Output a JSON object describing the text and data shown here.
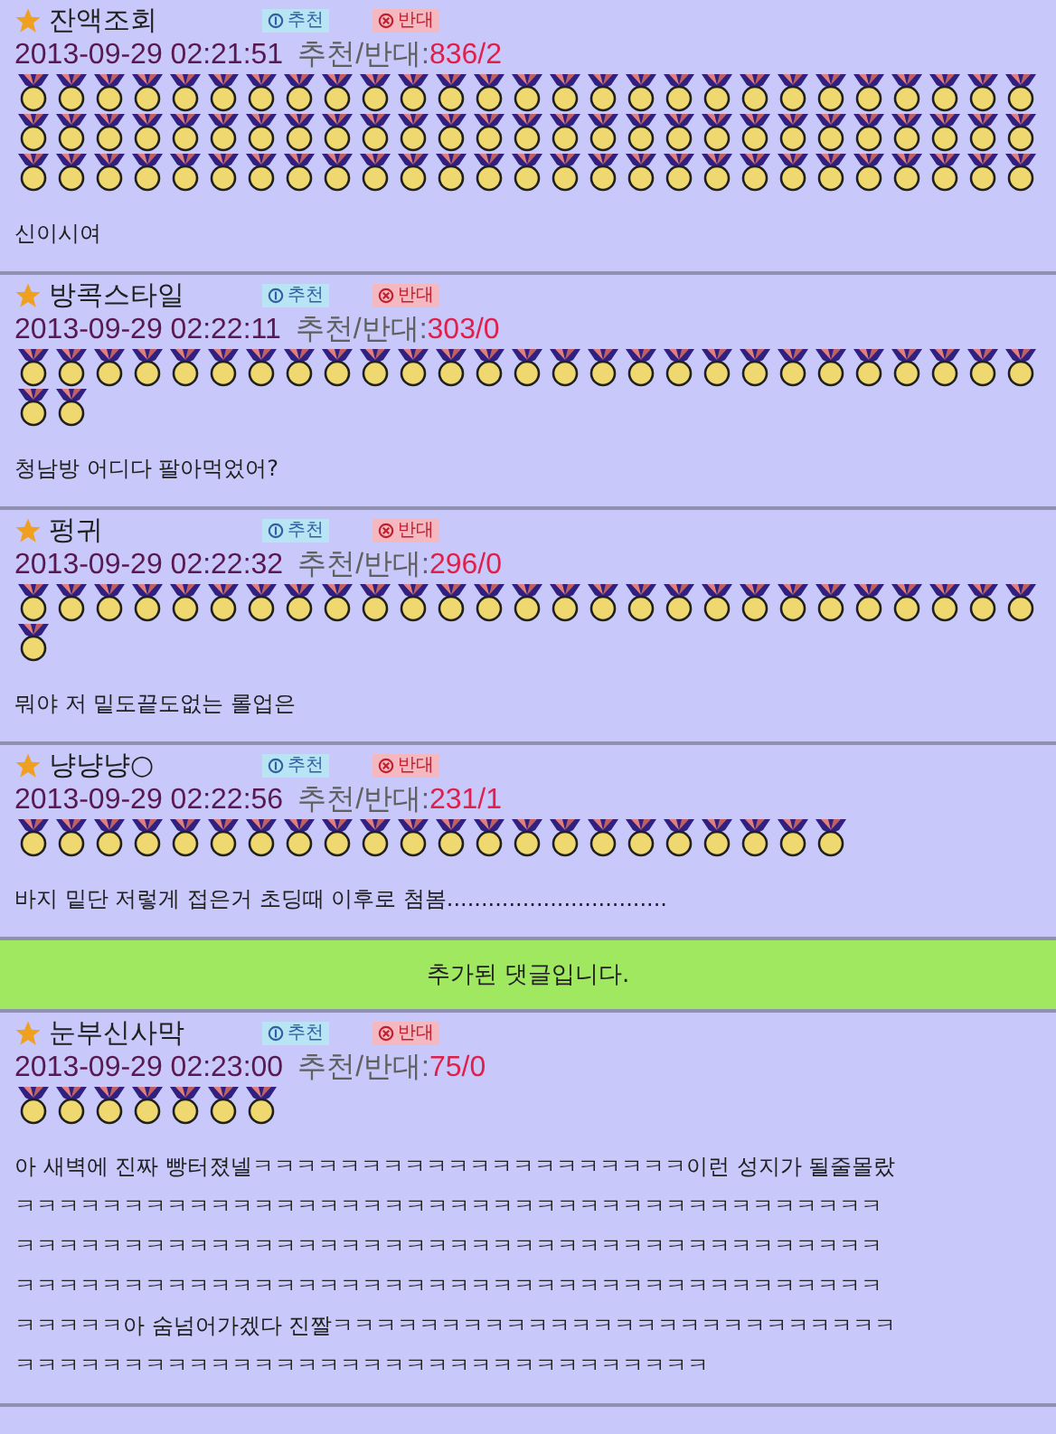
{
  "comments": [
    {
      "author": "잔액조회",
      "up_label": "추천",
      "down_label": "반대",
      "time": "2013-09-29 02:21:51",
      "score_label": "추천/반대:",
      "score": "836/2",
      "text": [
        "신이시여"
      ],
      "medals": [
        {
          "kind": "medal"
        },
        {
          "kind": "medal"
        },
        {
          "kind": "medal"
        },
        {
          "kind": "medal"
        },
        {
          "kind": "medal"
        },
        {
          "kind": "medal"
        },
        {
          "kind": "medal"
        },
        {
          "kind": "medal"
        },
        {
          "kind": "medal"
        },
        {
          "kind": "medal"
        },
        {
          "kind": "medal"
        },
        {
          "kind": "medal"
        },
        {
          "kind": "medal"
        },
        {
          "kind": "medal"
        },
        {
          "kind": "medal"
        },
        {
          "kind": "medal"
        },
        {
          "kind": "medal"
        },
        {
          "kind": "medal"
        },
        {
          "kind": "medal"
        },
        {
          "kind": "medal"
        },
        {
          "kind": "medal"
        },
        {
          "kind": "medal"
        },
        {
          "kind": "medal"
        },
        {
          "kind": "medal"
        },
        {
          "kind": "medal"
        },
        {
          "kind": "medal"
        },
        {
          "kind": "medal"
        },
        {
          "kind": "medal"
        },
        {
          "kind": "medal"
        },
        {
          "kind": "medal"
        },
        {
          "kind": "medal"
        },
        {
          "kind": "medal"
        },
        {
          "kind": "medal"
        },
        {
          "kind": "medal"
        },
        {
          "kind": "medal"
        },
        {
          "kind": "medal"
        },
        {
          "kind": "medal"
        },
        {
          "kind": "medal"
        },
        {
          "kind": "medal"
        },
        {
          "kind": "medal"
        },
        {
          "kind": "medal"
        },
        {
          "kind": "medal"
        },
        {
          "kind": "medal"
        },
        {
          "kind": "medal"
        },
        {
          "kind": "medal"
        },
        {
          "kind": "medal"
        },
        {
          "kind": "medal"
        },
        {
          "kind": "medal"
        },
        {
          "kind": "medal"
        },
        {
          "kind": "medal"
        },
        {
          "kind": "medal"
        },
        {
          "kind": "medal"
        },
        {
          "kind": "medal"
        },
        {
          "kind": "medal"
        },
        {
          "kind": "medal"
        },
        {
          "kind": "medal"
        },
        {
          "kind": "medal"
        },
        {
          "kind": "medal"
        },
        {
          "kind": "medal"
        },
        {
          "kind": "medal"
        },
        {
          "kind": "medal"
        },
        {
          "kind": "medal"
        },
        {
          "kind": "medal"
        },
        {
          "kind": "medal"
        },
        {
          "kind": "medal"
        },
        {
          "kind": "medal"
        },
        {
          "kind": "medal"
        },
        {
          "kind": "medal"
        },
        {
          "kind": "medal"
        },
        {
          "kind": "medal"
        },
        {
          "kind": "medal"
        },
        {
          "kind": "medal"
        },
        {
          "kind": "medal"
        },
        {
          "kind": "medal"
        },
        {
          "kind": "medal"
        },
        {
          "kind": "medal"
        },
        {
          "kind": "medal"
        },
        {
          "kind": "medal"
        },
        {
          "kind": "medal"
        },
        {
          "kind": "medal"
        },
        {
          "kind": "medal"
        }
      ]
    },
    {
      "author": "방콕스타일",
      "up_label": "추천",
      "down_label": "반대",
      "time": "2013-09-29 02:22:11",
      "score_label": "추천/반대:",
      "score": "303/0",
      "text": [
        "청남방 어디다 팔아먹었어?"
      ],
      "medals": [
        {
          "kind": "medal"
        },
        {
          "kind": "medal"
        },
        {
          "kind": "medal"
        },
        {
          "kind": "medal"
        },
        {
          "kind": "medal"
        },
        {
          "kind": "medal"
        },
        {
          "kind": "medal"
        },
        {
          "kind": "medal"
        },
        {
          "kind": "medal"
        },
        {
          "kind": "medal"
        },
        {
          "kind": "medal"
        },
        {
          "kind": "medal"
        },
        {
          "kind": "medal"
        },
        {
          "kind": "medal"
        },
        {
          "kind": "medal"
        },
        {
          "kind": "medal"
        },
        {
          "kind": "medal"
        },
        {
          "kind": "medal"
        },
        {
          "kind": "medal"
        },
        {
          "kind": "medal"
        },
        {
          "kind": "medal"
        },
        {
          "kind": "medal"
        },
        {
          "kind": "medal"
        },
        {
          "kind": "medal"
        },
        {
          "kind": "medal"
        },
        {
          "kind": "medal"
        },
        {
          "kind": "medal"
        },
        {
          "kind": "medal"
        },
        {
          "kind": "medal"
        }
      ]
    },
    {
      "author": "펑귀",
      "up_label": "추천",
      "down_label": "반대",
      "time": "2013-09-29 02:22:32",
      "score_label": "추천/반대:",
      "score": "296/0",
      "text": [
        "뭐야 저 밑도끝도없는 롤업은"
      ],
      "medals": [
        {
          "kind": "medal"
        },
        {
          "kind": "medal"
        },
        {
          "kind": "medal"
        },
        {
          "kind": "medal"
        },
        {
          "kind": "medal"
        },
        {
          "kind": "medal"
        },
        {
          "kind": "medal"
        },
        {
          "kind": "medal"
        },
        {
          "kind": "medal"
        },
        {
          "kind": "medal"
        },
        {
          "kind": "medal"
        },
        {
          "kind": "medal"
        },
        {
          "kind": "medal"
        },
        {
          "kind": "medal"
        },
        {
          "kind": "medal"
        },
        {
          "kind": "medal"
        },
        {
          "kind": "medal"
        },
        {
          "kind": "medal"
        },
        {
          "kind": "medal"
        },
        {
          "kind": "medal"
        },
        {
          "kind": "medal"
        },
        {
          "kind": "medal"
        },
        {
          "kind": "medal"
        },
        {
          "kind": "medal"
        },
        {
          "kind": "medal"
        },
        {
          "kind": "medal"
        },
        {
          "kind": "medal"
        },
        {
          "kind": "medal"
        }
      ]
    },
    {
      "author": "냥냥냥○",
      "up_label": "추천",
      "down_label": "반대",
      "time": "2013-09-29 02:22:56",
      "score_label": "추천/반대:",
      "score": "231/1",
      "text": [
        "바지 밑단 저렇게 접은거 초딩때 이후로 첨봄................................"
      ],
      "medals": [
        {
          "kind": "medal"
        },
        {
          "kind": "medal"
        },
        {
          "kind": "medal"
        },
        {
          "kind": "medal"
        },
        {
          "kind": "medal"
        },
        {
          "kind": "medal"
        },
        {
          "kind": "medal"
        },
        {
          "kind": "medal"
        },
        {
          "kind": "medal"
        },
        {
          "kind": "medal"
        },
        {
          "kind": "medal"
        },
        {
          "kind": "medal"
        },
        {
          "kind": "medal"
        },
        {
          "kind": "medal"
        },
        {
          "kind": "medal"
        },
        {
          "kind": "medal"
        },
        {
          "kind": "medal"
        },
        {
          "kind": "medal"
        },
        {
          "kind": "medal"
        },
        {
          "kind": "medal"
        },
        {
          "kind": "medal"
        },
        {
          "kind": "medal"
        }
      ]
    }
  ],
  "banner": "추가된 댓글입니다.",
  "added_comments": [
    {
      "author": "눈부신사막",
      "up_label": "추천",
      "down_label": "반대",
      "time": "2013-09-29 02:23:00",
      "score_label": "추천/반대:",
      "score": "75/0",
      "text": [
        "아 새벽에 진짜 빵터졌넬ㅋㅋㅋㅋㅋㅋㅋㅋㅋㅋㅋㅋㅋㅋㅋㅋㅋㅋㅋㅋ이런 성지가 될줄몰랐",
        "ㅋㅋㅋㅋㅋㅋㅋㅋㅋㅋㅋㅋㅋㅋㅋㅋㅋㅋㅋㅋㅋㅋㅋㅋㅋㅋㅋㅋㅋㅋㅋㅋㅋㅋㅋㅋㅋㅋㅋㅋ",
        "ㅋㅋㅋㅋㅋㅋㅋㅋㅋㅋㅋㅋㅋㅋㅋㅋㅋㅋㅋㅋㅋㅋㅋㅋㅋㅋㅋㅋㅋㅋㅋㅋㅋㅋㅋㅋㅋㅋㅋㅋ",
        "ㅋㅋㅋㅋㅋㅋㅋㅋㅋㅋㅋㅋㅋㅋㅋㅋㅋㅋㅋㅋㅋㅋㅋㅋㅋㅋㅋㅋㅋㅋㅋㅋㅋㅋㅋㅋㅋㅋㅋㅋ",
        "ㅋㅋㅋㅋㅋ아 숨넘어가겠다 진짤ㅋㅋㅋㅋㅋㅋㅋㅋㅋㅋㅋㅋㅋㅋㅋㅋㅋㅋㅋㅋㅋㅋㅋㅋㅋㅋ",
        "ㅋㅋㅋㅋㅋㅋㅋㅋㅋㅋㅋㅋㅋㅋㅋㅋㅋㅋㅋㅋㅋㅋㅋㅋㅋㅋㅋㅋㅋㅋㅋㅋ"
      ],
      "medals": [
        {
          "kind": "medal"
        },
        {
          "kind": "medal"
        },
        {
          "kind": "medal"
        },
        {
          "kind": "medal"
        },
        {
          "kind": "medal"
        },
        {
          "kind": "medal"
        },
        {
          "kind": "medal"
        }
      ]
    }
  ]
}
